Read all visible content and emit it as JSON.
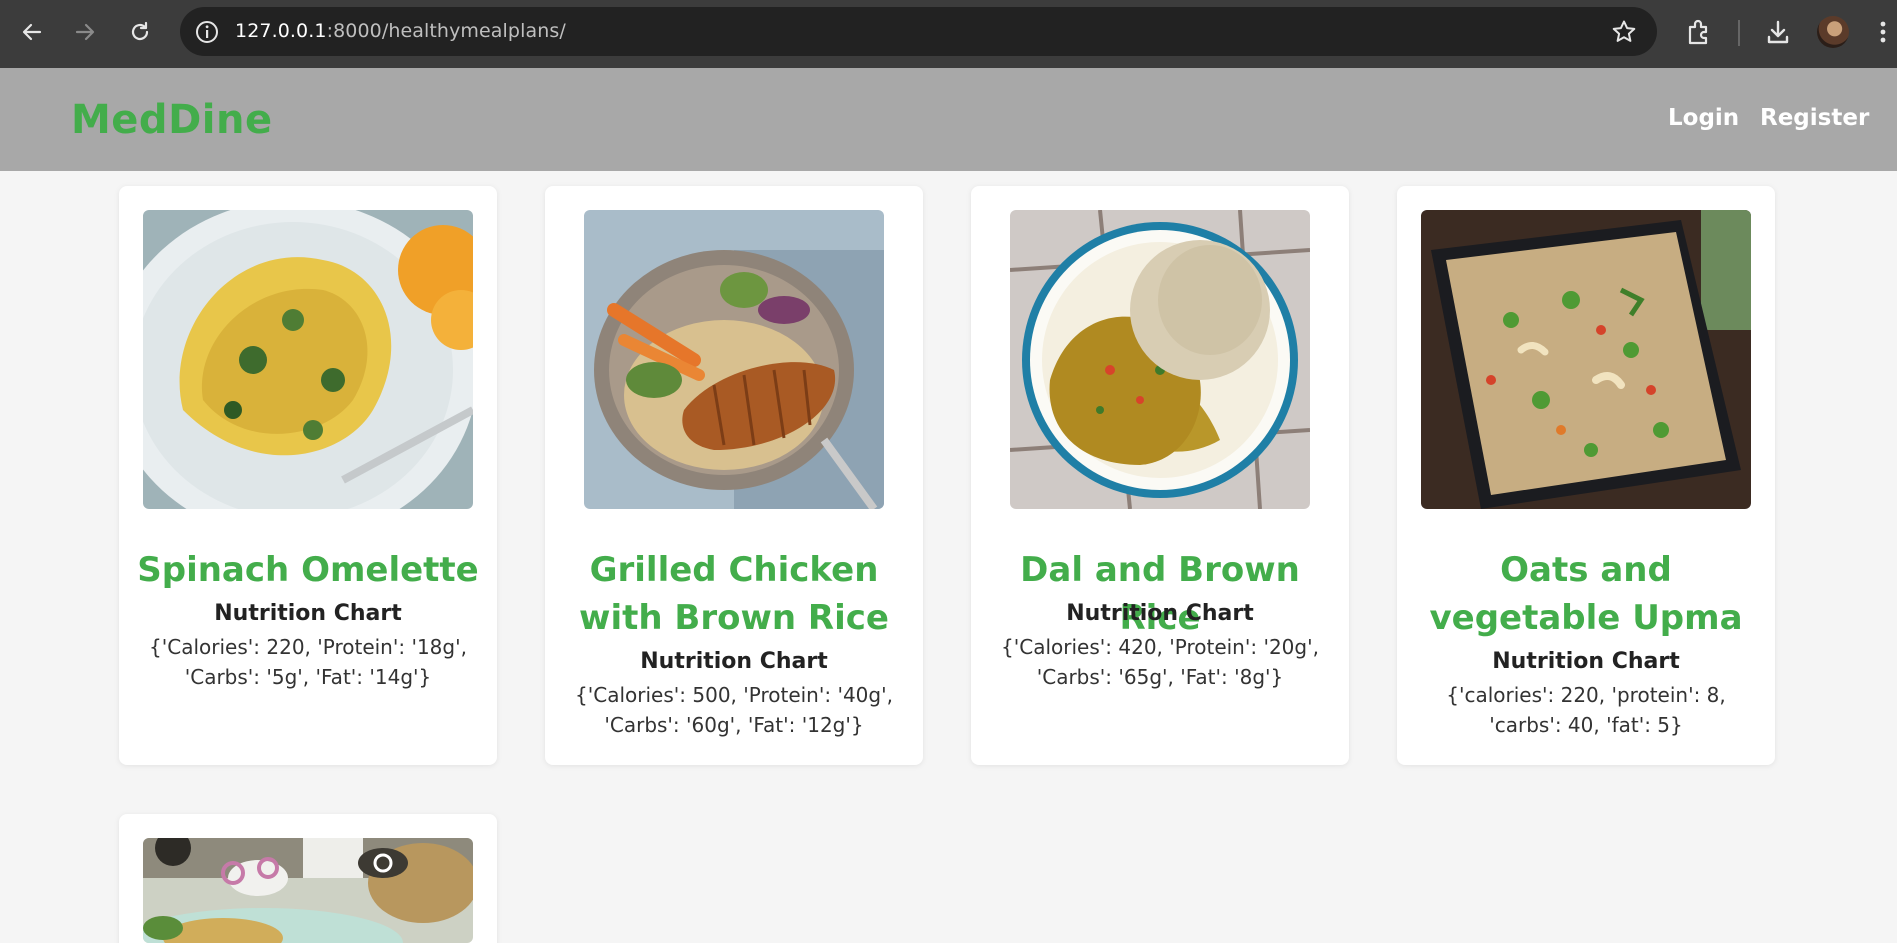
{
  "browser": {
    "url_host": "127.0.0.1",
    "url_path": ":8000/healthymealplans/"
  },
  "header": {
    "logo": "MedDine",
    "nav": {
      "login": "Login",
      "register": "Register"
    }
  },
  "meals": [
    {
      "title": "Spinach Omelette",
      "nutrition_heading": "Nutrition Chart",
      "nutrition": "{'Calories': 220, 'Protein': '18g', 'Carbs': '5g', 'Fat': '14g'}"
    },
    {
      "title": "Grilled Chicken with Brown Rice",
      "nutrition_heading": "Nutrition Chart",
      "nutrition": "{'Calories': 500, 'Protein': '40g', 'Carbs': '60g', 'Fat': '12g'}"
    },
    {
      "title": "Dal and Brown Rice",
      "nutrition_heading": "Nutrition Chart",
      "nutrition": "{'Calories': 420, 'Protein': '20g', 'Carbs': '65g', 'Fat': '8g'}"
    },
    {
      "title": "Oats and vegetable Upma",
      "nutrition_heading": "Nutrition Chart",
      "nutrition": "{'calories': 220, 'protein': 8, 'carbs': 40, 'fat': 5}"
    }
  ],
  "colors": {
    "brand_green": "#43ad4b",
    "header_bg": "#a8a8a8",
    "page_bg": "#f5f5f5"
  }
}
